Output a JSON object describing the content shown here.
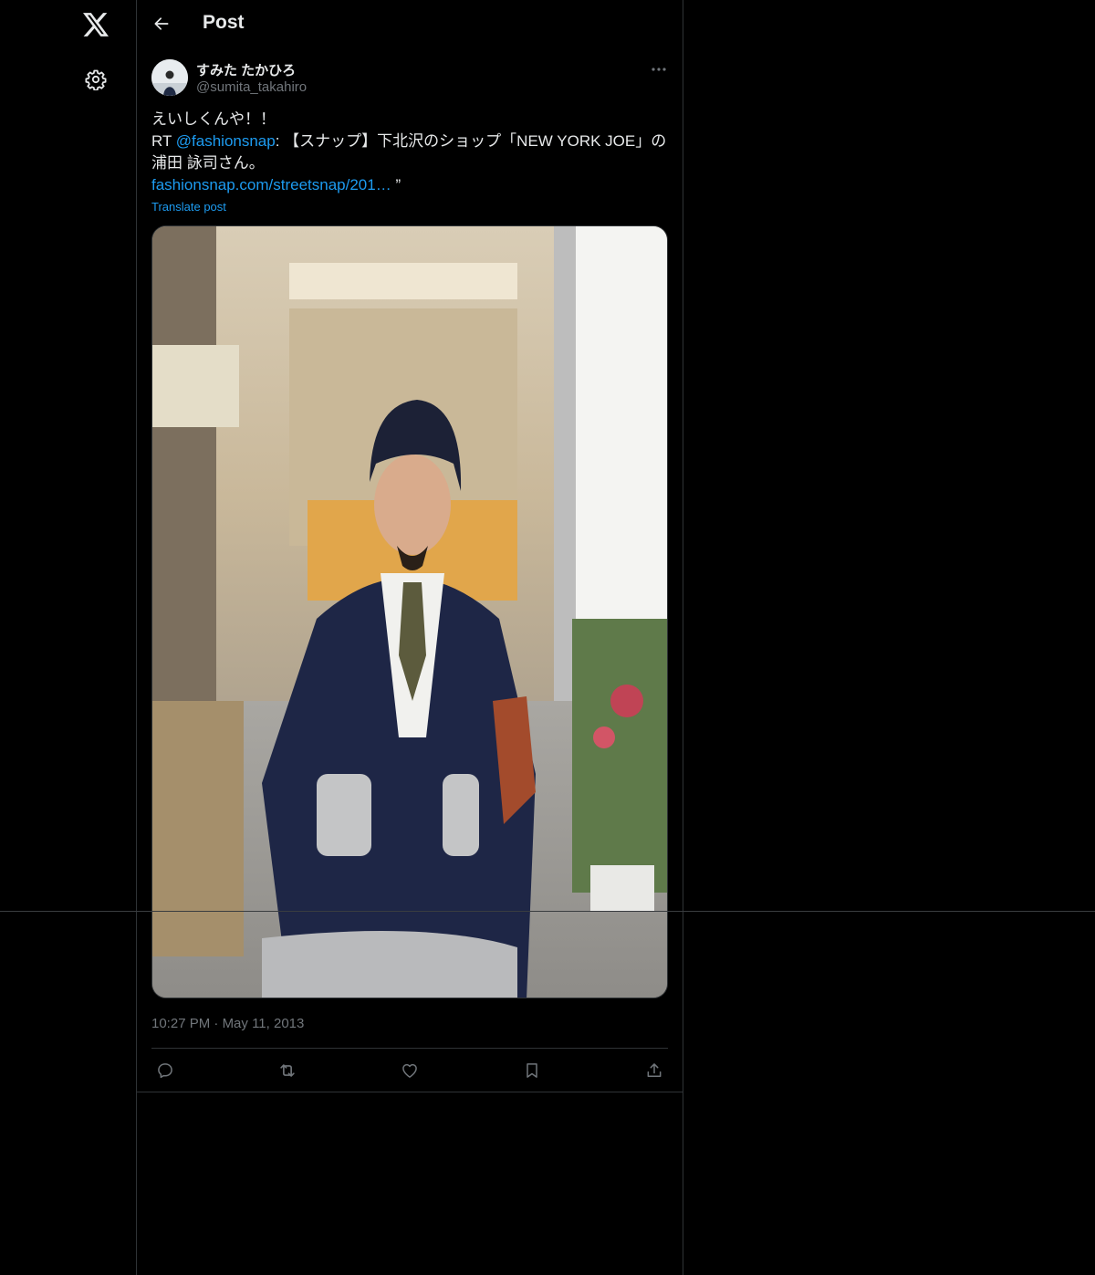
{
  "nav": {
    "logo_icon": "x-logo-icon",
    "settings_icon": "gear-icon"
  },
  "header": {
    "title": "Post",
    "back_icon": "arrow-left-icon"
  },
  "post": {
    "author": {
      "display_name": "すみた たかひろ",
      "handle": "@sumita_takahiro"
    },
    "text": {
      "line1": "えいしくんや！！",
      "rt_prefix": "RT ",
      "mention": "@fashionsnap",
      "line2_rest": ": 【スナップ】下北沢のショップ「NEW YORK JOE」の",
      "line3": "浦田 詠司さん。",
      "url": "fashionsnap.com/streetsnap/201…",
      "url_suffix": " ”"
    },
    "translate_label": "Translate post",
    "timestamp": {
      "time": "10:27 PM",
      "separator": " · ",
      "date": "May 11, 2013"
    },
    "actions": [
      "reply-icon",
      "repost-icon",
      "like-icon",
      "bookmark-icon",
      "share-icon"
    ]
  },
  "colors": {
    "background": "#000000",
    "text": "#e7e9ea",
    "secondary_text": "#71767b",
    "link": "#1d9bf0",
    "border": "#2f3336"
  }
}
